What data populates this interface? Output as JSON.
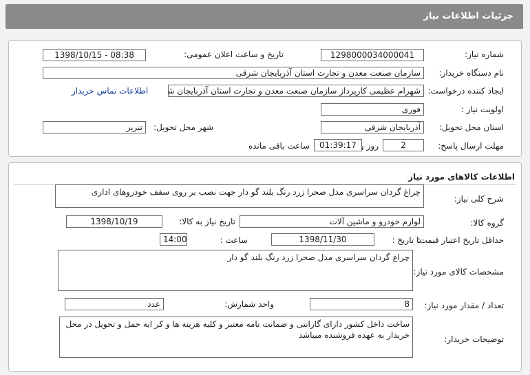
{
  "header": {
    "title": "جزئیات اطلاعات نیاز"
  },
  "info": {
    "need_number_label": "شماره نیاز:",
    "need_number": "1298000034000041",
    "announce_datetime_label": "تاریخ و ساعت اعلان عمومی:",
    "announce_datetime": "1398/10/15 - 08:38",
    "buyer_org_label": "نام دستگاه خریدار:",
    "buyer_org": "سازمان صنعت معدن و تجارت استان آذربایجان شرقی",
    "creator_label": "ایجاد کننده درخواست:",
    "creator": "شهرام عظیمی کارپرداز سازمان صنعت معدن و تجارت استان آذربایجان شرقی",
    "contact_link": "اطلاعات تماس خریدار",
    "priority_label": "اولویت نیاز :",
    "priority": "فوری",
    "province_label": "استان محل تحویل:",
    "province": "آذربایجان شرقی",
    "city_label": "شهر محل تحویل:",
    "city": "تبریز",
    "deadline_label": "مهلت ارسال پاسخ:",
    "days_value": "2",
    "days_label": "روز و",
    "time_value": "01:39:17",
    "time_remaining_label": "ساعت باقی مانده"
  },
  "goods": {
    "section_title": "اطلاعات کالاهای مورد نیاز",
    "general_desc_label": "شرح کلی نیاز:",
    "general_desc": "چراغ گردان سراسری مدل صحرا زرد رنگ بلند گو دار جهت نصب بر روی سقف خودروهای اداری",
    "group_label": "گروه کالا:",
    "group": "لوازم خودرو و ماشین آلات",
    "need_date_label": "تاریخ نیاز به کالا:",
    "need_date": "1398/10/19",
    "min_validity_label": "حداقل تاریخ اعتبار قیمت:",
    "until_date_label": "تا تاریخ :",
    "until_date": "1398/11/30",
    "hour_label": "ساعت :",
    "hour": "14:00",
    "spec_label": "مشخصات کالای مورد نیاز:",
    "spec": "چراغ گردان سراسری مدل صحرا زرد رنگ بلند گو دار",
    "qty_label": "تعداد / مقدار مورد نیاز:",
    "qty": "8",
    "unit_label": "واحد شمارش:",
    "unit": "عدد",
    "buyer_notes_label": "توضیحات خریدار:",
    "buyer_notes": "ساخت داخل کشور دارای گارانتی و ضمانت نامه معتبر و کلیه هزینه ها و کر ایه حمل و تحویل در محل خریدار به عهده فروشنده میباشد"
  }
}
